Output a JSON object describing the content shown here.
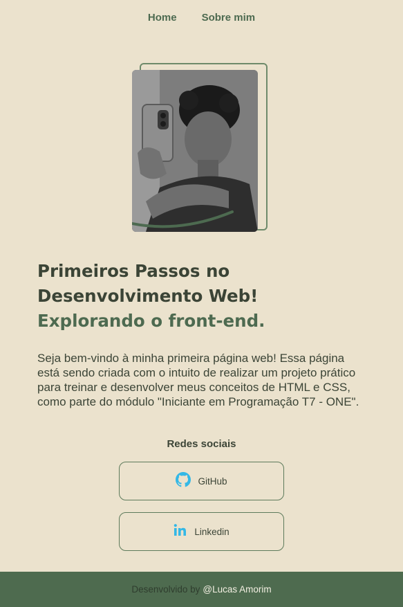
{
  "nav": {
    "items": [
      "Home",
      "Sobre mim"
    ]
  },
  "hero": {
    "title_main": "Primeiros Passos no Desenvolvimento Web!",
    "title_accent": "Explorando o front-end.",
    "intro": "Seja bem-vindo à minha primeira página web! Essa página está sendo criada com o intuito de realizar um projeto prático para treinar e desenvolver meus conceitos de HTML e CSS, como parte do módulo \"Iniciante em Programação T7 - ONE\"."
  },
  "social": {
    "title": "Redes sociais",
    "github_label": "GitHub",
    "linkedin_label": "Linkedin",
    "icon_color": "#34b8e6"
  },
  "footer": {
    "prefix": "Desenvolvido by",
    "author": "@Lucas Amorim"
  },
  "colors": {
    "background": "#ebe2cd",
    "accent": "#4d6a50",
    "text": "#3b4436",
    "footer": "#4e6b4f"
  }
}
